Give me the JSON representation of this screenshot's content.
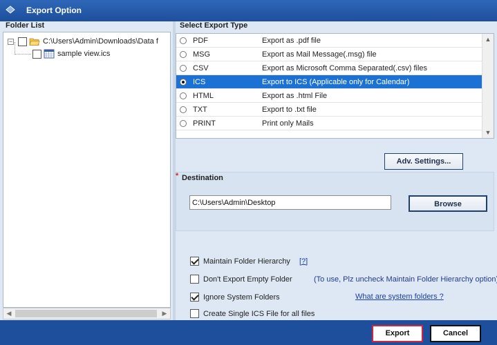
{
  "window": {
    "title": "Export Option"
  },
  "folder_panel": {
    "label": "Folder List",
    "tree": [
      {
        "label": "C:\\Users\\Admin\\Downloads\\Data f",
        "expander": "−",
        "checked": false,
        "icon": "open-folder-icon"
      },
      {
        "label": "sample view.ics",
        "checked": false,
        "icon": "calendar-file-icon"
      }
    ]
  },
  "export_panel": {
    "label": "Select Export Type",
    "options": [
      {
        "type": "PDF",
        "desc": "Export as .pdf file",
        "selected": false
      },
      {
        "type": "MSG",
        "desc": "Export as Mail Message(.msg) file",
        "selected": false
      },
      {
        "type": "CSV",
        "desc": "Export as Microsoft Comma Separated(.csv) files",
        "selected": false
      },
      {
        "type": "ICS",
        "desc": "Export to ICS (Applicable only for Calendar)",
        "selected": true
      },
      {
        "type": "HTML",
        "desc": "Export as .html File",
        "selected": false
      },
      {
        "type": "TXT",
        "desc": "Export to .txt file",
        "selected": false
      },
      {
        "type": "PRINT",
        "desc": "Print only Mails",
        "selected": false
      }
    ],
    "adv_settings_label": "Adv. Settings..."
  },
  "destination": {
    "required_mark": "*",
    "label": "Destination",
    "path": "C:\\Users\\Admin\\Desktop",
    "browse_label": "Browse"
  },
  "options": {
    "maintain_hierarchy": {
      "label": "Maintain Folder Hierarchy",
      "checked": true,
      "help": "[?]"
    },
    "dont_export_empty": {
      "label": "Don't Export Empty Folder",
      "checked": false,
      "hint": "(To use, Plz uncheck Maintain Folder Hierarchy option)"
    },
    "ignore_system": {
      "label": "Ignore System Folders",
      "checked": true,
      "link": "What are system folders ?"
    },
    "single_ics": {
      "label": "Create Single ICS File for all files",
      "checked": false
    }
  },
  "footer": {
    "export_label": "Export",
    "cancel_label": "Cancel"
  },
  "colors": {
    "title_bar": "#1d4f9c",
    "selection": "#1c72d4",
    "primary_border": "#d8243a"
  }
}
